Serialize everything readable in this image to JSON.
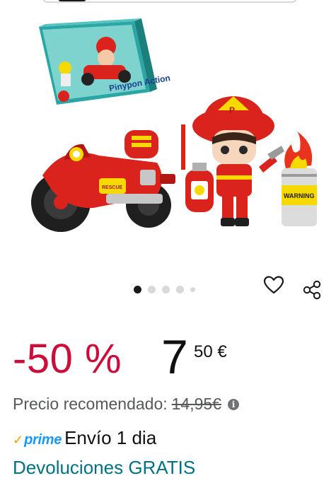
{
  "carousel": {
    "image_alt": "Pinypon Action firefighter figure with red motorbike, fire extinguisher and warning barrel",
    "box_brand": "Pinypon Action",
    "motorbike_label": "RESCUE",
    "barrel_label": "WARNING",
    "helmet_badge": "P",
    "dots_total": 5,
    "active_index": 0
  },
  "actions": {
    "wishlist_icon": "heart-icon",
    "share_icon": "share-icon"
  },
  "price": {
    "discount": "-50 %",
    "whole": "7",
    "fraction": "50 €"
  },
  "rrp": {
    "label": "Precio recomendado:",
    "value": "14,95€",
    "info_icon": "i"
  },
  "delivery": {
    "prime_check": "✓",
    "prime_label": "prime",
    "text": "Envío 1 dia"
  },
  "returns": {
    "text": "Devoluciones GRATIS"
  },
  "colors": {
    "discount_red": "#cc0c39",
    "link_teal": "#007185",
    "prime_blue": "#1a98ff",
    "prime_orange": "#ff9900"
  }
}
